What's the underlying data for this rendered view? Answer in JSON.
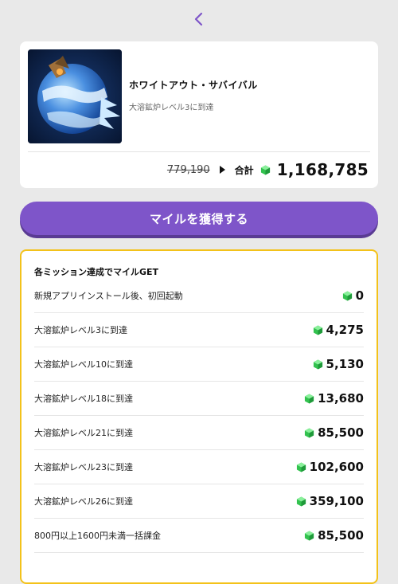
{
  "app": {
    "title": "ホワイトアウト・サバイバル",
    "subtitle": "大溶鉱炉レベル3に到達",
    "old_price": "779,190",
    "total_label": "合計",
    "total_value": "1,168,785"
  },
  "cta": {
    "label": "マイルを獲得する"
  },
  "missions": {
    "heading": "各ミッション達成でマイルGET",
    "items": [
      {
        "label": "新規アプリインストール後、初回起動",
        "value": "0"
      },
      {
        "label": "大溶鉱炉レベル3に到達",
        "value": "4,275"
      },
      {
        "label": "大溶鉱炉レベル10に到達",
        "value": "5,130"
      },
      {
        "label": "大溶鉱炉レベル18に到達",
        "value": "13,680"
      },
      {
        "label": "大溶鉱炉レベル21に到達",
        "value": "85,500"
      },
      {
        "label": "大溶鉱炉レベル23に到達",
        "value": "102,600"
      },
      {
        "label": "大溶鉱炉レベル26に到達",
        "value": "359,100"
      },
      {
        "label": "800円以上1600円未満一括課金",
        "value": "85,500"
      }
    ]
  },
  "colors": {
    "accent": "#7e55c9",
    "border": "#f3c21a",
    "gem": "#3fcf5a"
  },
  "icons": {
    "back": "chevron-left-icon",
    "gem": "green-gem-icon",
    "arrow": "triangle-right-icon"
  }
}
